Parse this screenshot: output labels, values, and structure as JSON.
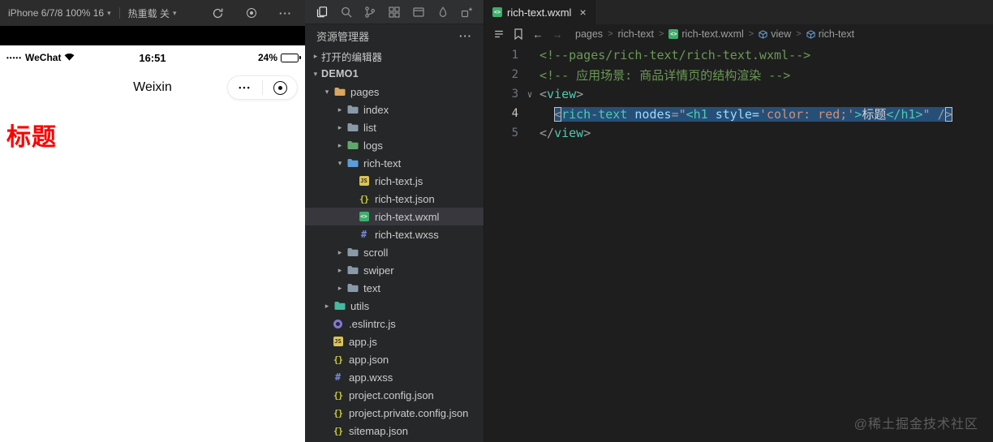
{
  "colors": {
    "accent_red": "#fe0000",
    "selection_blue": "#264f78",
    "comment_green": "#6a9955",
    "tag_teal": "#4ec9b0",
    "attr_blue": "#9cdcfe",
    "string_orange": "#ce9178"
  },
  "icons": {
    "caret_down": "▾",
    "chevron_right": "▸",
    "chevron_down": "▾",
    "more_horizontal": "···",
    "close": "×",
    "back_arrow": "←",
    "forward_arrow": "→",
    "fold_arrow": "∨",
    "breadcrumb_separator": ">",
    "js_glyph": "JS",
    "json_glyph": "{}",
    "wxml_glyph": "<>",
    "wxss_glyph": "#"
  },
  "simulator": {
    "toolbar": {
      "device_label": "iPhone 6/7/8 100% 16",
      "hot_reload_label": "热重载 关"
    },
    "status_bar": {
      "signal_dots": "•••••",
      "carrier": "WeChat",
      "time": "16:51",
      "battery_percent": "24%"
    },
    "nav_bar": {
      "title": "Weixin",
      "menu_dots": "•••"
    },
    "page": {
      "heading": "标题"
    }
  },
  "activity_bar": {
    "items": [
      "files",
      "search",
      "source-control",
      "extensions",
      "preview",
      "cloud",
      "plugin"
    ]
  },
  "explorer": {
    "title": "资源管理器",
    "open_editors_label": "打开的编辑器",
    "project_label": "DEMO1",
    "tree": [
      {
        "label": "pages",
        "kind": "folder",
        "level": 1,
        "state": "expanded",
        "folderColor": "#d7a65f"
      },
      {
        "label": "index",
        "kind": "folder",
        "level": 2,
        "state": "collapsed",
        "folderColor": "#8a99a8"
      },
      {
        "label": "list",
        "kind": "folder",
        "level": 2,
        "state": "collapsed",
        "folderColor": "#8a99a8"
      },
      {
        "label": "logs",
        "kind": "folder",
        "level": 2,
        "state": "collapsed",
        "folderColor": "#5fa86b"
      },
      {
        "label": "rich-text",
        "kind": "folder",
        "level": 2,
        "state": "expanded",
        "folderColor": "#5b9dd6"
      },
      {
        "label": "rich-text.js",
        "kind": "file",
        "icon": "js",
        "level": 3
      },
      {
        "label": "rich-text.json",
        "kind": "file",
        "icon": "json",
        "level": 3
      },
      {
        "label": "rich-text.wxml",
        "kind": "file",
        "icon": "wxml",
        "level": 3,
        "selected": true
      },
      {
        "label": "rich-text.wxss",
        "kind": "file",
        "icon": "wxss",
        "level": 3
      },
      {
        "label": "scroll",
        "kind": "folder",
        "level": 2,
        "state": "collapsed",
        "folderColor": "#8a99a8"
      },
      {
        "label": "swiper",
        "kind": "folder",
        "level": 2,
        "state": "collapsed",
        "folderColor": "#8a99a8"
      },
      {
        "label": "text",
        "kind": "folder",
        "level": 2,
        "state": "collapsed",
        "folderColor": "#8a99a8"
      },
      {
        "label": "utils",
        "kind": "folder",
        "level": 1,
        "state": "collapsed",
        "folderColor": "#45b8a0"
      },
      {
        "label": ".eslintrc.js",
        "kind": "file",
        "icon": "eslint",
        "level": 1
      },
      {
        "label": "app.js",
        "kind": "file",
        "icon": "js",
        "level": 1
      },
      {
        "label": "app.json",
        "kind": "file",
        "icon": "json",
        "level": 1
      },
      {
        "label": "app.wxss",
        "kind": "file",
        "icon": "wxss",
        "level": 1
      },
      {
        "label": "project.config.json",
        "kind": "file",
        "icon": "json",
        "level": 1
      },
      {
        "label": "project.private.config.json",
        "kind": "file",
        "icon": "json",
        "level": 1
      },
      {
        "label": "sitemap.json",
        "kind": "file",
        "icon": "json",
        "level": 1
      }
    ]
  },
  "editor": {
    "tab": {
      "label": "rich-text.wxml"
    },
    "breadcrumb": [
      {
        "label": "pages"
      },
      {
        "label": "rich-text"
      },
      {
        "label": "rich-text.wxml",
        "icon": "wxml"
      },
      {
        "label": "view",
        "icon": "symbol"
      },
      {
        "label": "rich-text",
        "icon": "symbol"
      }
    ],
    "code": {
      "lines": [
        {
          "num": 1,
          "tokens": [
            {
              "t": "<!--pages/rich-text/rich-text.wxml-->",
              "c": "comment"
            }
          ]
        },
        {
          "num": 2,
          "tokens": [
            {
              "t": "<!-- 应用场景: 商品详情页的结构渲染 -->",
              "c": "comment"
            }
          ]
        },
        {
          "num": 3,
          "fold": true,
          "tokens": [
            {
              "t": "<",
              "c": "punct"
            },
            {
              "t": "view",
              "c": "tag"
            },
            {
              "t": ">",
              "c": "punct"
            }
          ]
        },
        {
          "num": 4,
          "active": true,
          "tokens": [
            {
              "t": "  ",
              "c": "plain"
            },
            {
              "t": "<",
              "c": "punct",
              "sel": true,
              "box": true
            },
            {
              "t": "rich-text",
              "c": "tag",
              "sel": true
            },
            {
              "t": " ",
              "c": "plain",
              "sel": true
            },
            {
              "t": "nodes",
              "c": "attr",
              "sel": true
            },
            {
              "t": "=",
              "c": "punct",
              "sel": true
            },
            {
              "t": "\"",
              "c": "string",
              "sel": true
            },
            {
              "t": "<h1 ",
              "c": "tag",
              "sel": true
            },
            {
              "t": "style=",
              "c": "attr",
              "sel": true
            },
            {
              "t": "'color: red;'",
              "c": "string",
              "sel": true
            },
            {
              "t": ">",
              "c": "tag",
              "sel": true
            },
            {
              "t": "标题",
              "c": "plain",
              "sel": true
            },
            {
              "t": "</h1>",
              "c": "tag",
              "sel": true
            },
            {
              "t": "\"",
              "c": "string",
              "sel": true
            },
            {
              "t": " /",
              "c": "punct",
              "sel": true
            },
            {
              "t": ">",
              "c": "punct",
              "sel": true,
              "box": true
            }
          ]
        },
        {
          "num": 5,
          "tokens": [
            {
              "t": "</",
              "c": "punct"
            },
            {
              "t": "view",
              "c": "tag"
            },
            {
              "t": ">",
              "c": "punct"
            }
          ]
        }
      ]
    },
    "watermark": "@稀土掘金技术社区"
  }
}
